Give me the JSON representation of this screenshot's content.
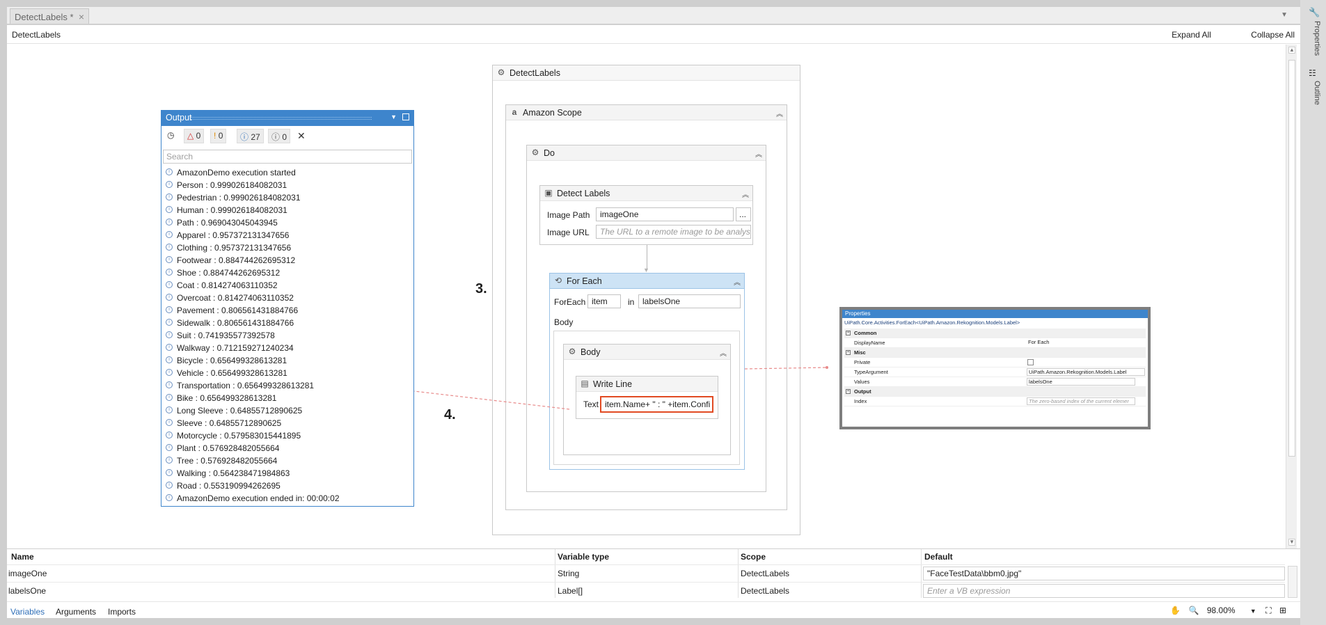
{
  "doc_tab": {
    "label": "DetectLabels *",
    "close": "×"
  },
  "breadcrumb": "DetectLabels",
  "toolbar": {
    "expand_all": "Expand All",
    "collapse_all": "Collapse All"
  },
  "right_strip": {
    "properties": "Properties",
    "outline": "Outline"
  },
  "workflow": {
    "root": "DetectLabels",
    "scope": "Amazon Scope",
    "do": "Do",
    "detect": {
      "title": "Detect Labels",
      "image_path_label": "Image Path",
      "image_path_value": "imageOne",
      "image_url_label": "Image URL",
      "image_url_placeholder": "The URL to a remote image to be analyse",
      "browse": "..."
    },
    "foreach": {
      "title": "For Each",
      "foreach_label": "ForEach",
      "item": "item",
      "in_label": "in",
      "collection": "labelsOne",
      "body_label": "Body",
      "body_title": "Body"
    },
    "writeline": {
      "title": "Write Line",
      "text_label": "Text",
      "text_value": "item.Name+ \" : \" +item.Confi"
    }
  },
  "callouts": {
    "three": "3.",
    "four": "4."
  },
  "output": {
    "title": "Output",
    "counts": {
      "errors": "0",
      "warnings": "0",
      "info": "27",
      "trace": "0"
    },
    "search_placeholder": "Search",
    "lines": [
      "AmazonDemo execution started",
      "Person : 0.999026184082031",
      "Pedestrian : 0.999026184082031",
      "Human : 0.999026184082031",
      "Path : 0.969043045043945",
      "Apparel : 0.957372131347656",
      "Clothing : 0.957372131347656",
      "Footwear : 0.884744262695312",
      "Shoe : 0.884744262695312",
      "Coat : 0.814274063110352",
      "Overcoat : 0.814274063110352",
      "Pavement : 0.806561431884766",
      "Sidewalk : 0.806561431884766",
      "Suit : 0.741935577392578",
      "Walkway : 0.712159271240234",
      "Bicycle : 0.656499328613281",
      "Vehicle : 0.656499328613281",
      "Transportation : 0.656499328613281",
      "Bike : 0.656499328613281",
      "Long Sleeve : 0.64855712890625",
      "Sleeve : 0.64855712890625",
      "Motorcycle : 0.579583015441895",
      "Plant : 0.576928482055664",
      "Tree : 0.576928482055664",
      "Walking : 0.564238471984863",
      "Road : 0.553190994262695",
      "AmazonDemo execution ended in: 00:00:02"
    ]
  },
  "properties": {
    "title": "Properties",
    "type": "UiPath.Core.Activities.ForEach<UiPath.Amazon.Rekognition.Models.Label>",
    "cat_common": "Common",
    "displayname_k": "DisplayName",
    "displayname_v": "For Each",
    "cat_misc": "Misc",
    "private_k": "Private",
    "typeargument_k": "TypeArgument",
    "typeargument_v": "UiPath.Amazon.Rekognition.Models.Label",
    "values_k": "Values",
    "values_v": "labelsOne",
    "cat_output": "Output",
    "index_k": "Index",
    "index_v": "The zero-based index of the current elemer"
  },
  "variables": {
    "headers": {
      "name": "Name",
      "type": "Variable type",
      "scope": "Scope",
      "default": "Default"
    },
    "rows": [
      {
        "name": "imageOne",
        "type": "String",
        "scope": "DetectLabels",
        "default": "\"FaceTestData\\bbm0.jpg\""
      },
      {
        "name": "labelsOne",
        "type": "Label[]",
        "scope": "DetectLabels",
        "default": "Enter a VB expression"
      }
    ]
  },
  "bottom_tabs": {
    "variables": "Variables",
    "arguments": "Arguments",
    "imports": "Imports"
  },
  "zoom": "98.00%"
}
